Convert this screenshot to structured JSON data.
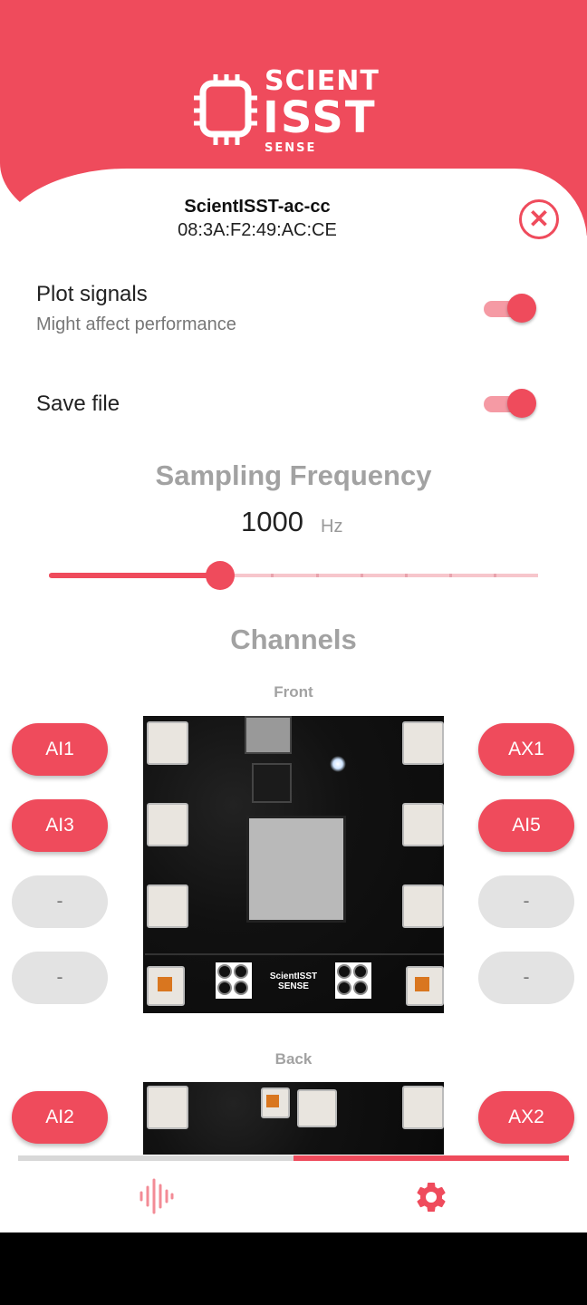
{
  "header": {
    "logo_line1": "SCIENT",
    "logo_line2": "ISST",
    "logo_line3": "SENSE"
  },
  "device": {
    "name": "ScientISST-ac-cc",
    "mac": "08:3A:F2:49:AC:CE"
  },
  "settings": {
    "plot_signals": {
      "title": "Plot signals",
      "subtitle": "Might affect performance",
      "enabled": true
    },
    "save_file": {
      "title": "Save file",
      "enabled": true
    }
  },
  "sampling": {
    "title": "Sampling Frequency",
    "value": "1000",
    "unit": "Hz",
    "slider_fraction": 0.35
  },
  "channels": {
    "title": "Channels",
    "front_label": "Front",
    "back_label": "Back",
    "front_left": [
      "AI1",
      "AI3",
      "-",
      "-"
    ],
    "front_right": [
      "AX1",
      "AI5",
      "-",
      "-"
    ],
    "back_left": [
      "AI2"
    ],
    "back_right": [
      "AX2"
    ],
    "board_text": "ScientISST\nSENSE"
  },
  "nav": {
    "items": [
      "signal-icon",
      "settings-gear-icon"
    ],
    "active_index": 1
  },
  "colors": {
    "accent": "#ef4b5c",
    "accent_light": "#f59aa4",
    "inactive": "#e3e3e3"
  }
}
